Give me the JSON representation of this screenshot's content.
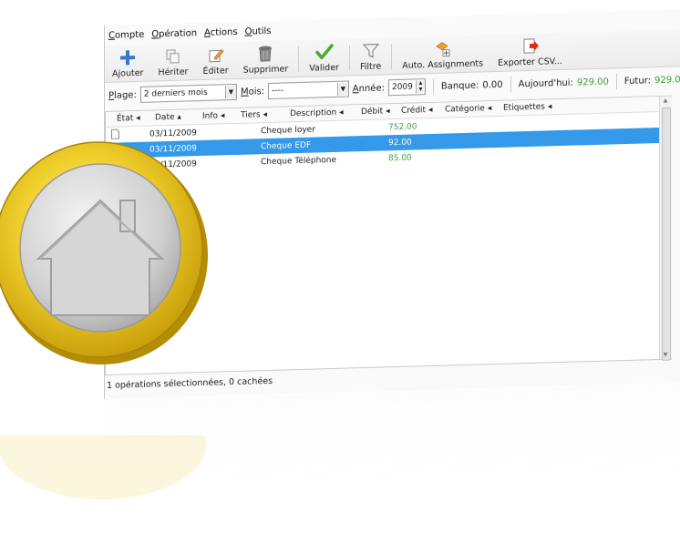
{
  "menu": [
    "Compte",
    "Opération",
    "Actions",
    "Outils"
  ],
  "toolbar": [
    {
      "label": "Ajouter",
      "icon": "plus-icon"
    },
    {
      "label": "Hériter",
      "icon": "inherit-icon"
    },
    {
      "label": "Éditer",
      "icon": "edit-icon"
    },
    {
      "label": "Supprimer",
      "icon": "trash-icon"
    },
    {
      "label": "Valider",
      "icon": "check-icon"
    },
    {
      "label": "Filtre",
      "icon": "filter-icon"
    },
    {
      "label": "Auto. Assignments",
      "icon": "auto-assign-icon"
    },
    {
      "label": "Exporter CSV...",
      "icon": "export-icon"
    }
  ],
  "filters": {
    "range_label": "Plage:",
    "range_value": "2 derniers mois",
    "month_label": "Mois:",
    "month_value": "----",
    "year_label": "Année:",
    "year_value": "2009",
    "bank_label": "Banque:",
    "bank_value": "0.00",
    "today_label": "Aujourd'hui:",
    "today_value": "929.00",
    "future_label": "Futur:",
    "future_value": "929.00"
  },
  "columns": [
    "État",
    "Date",
    "Info",
    "Tiers",
    "Description",
    "Débit",
    "Crédit",
    "Catégorie",
    "Etiquettes"
  ],
  "rows": [
    {
      "date": "03/11/2009",
      "description": "Cheque loyer",
      "credit": "752.00",
      "selected": false
    },
    {
      "date": "03/11/2009",
      "description": "Cheque EDF",
      "credit": "92.00",
      "selected": true
    },
    {
      "date": "03/11/2009",
      "description": "Cheque Téléphone",
      "credit": "85.00",
      "selected": false
    }
  ],
  "status": "1 opérations sélectionnées, 0 cachées",
  "colors": {
    "selection": "#3399e8",
    "positive": "#3aa23a",
    "coin_gold": "#e8c21c",
    "coin_silver": "#c9c9c9"
  }
}
